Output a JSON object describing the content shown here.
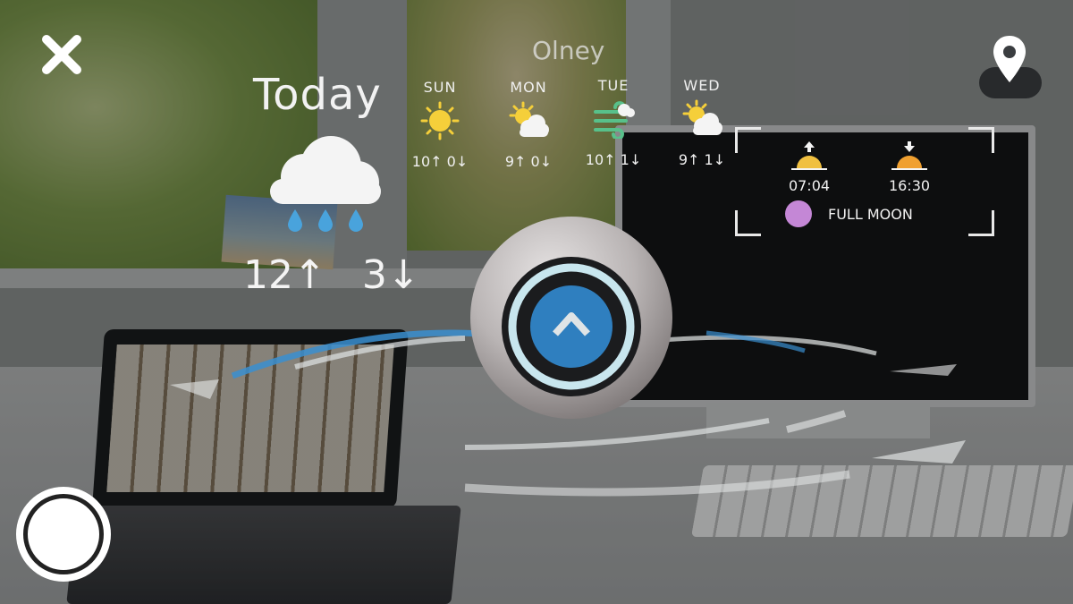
{
  "location_name": "Olney",
  "today": {
    "title": "Today",
    "condition_icon": "rain-cloud-icon",
    "high": "12",
    "low": "3"
  },
  "forecast": [
    {
      "day": "SUN",
      "icon": "sun-icon",
      "high": "10",
      "low": "0"
    },
    {
      "day": "MON",
      "icon": "sun-cloud-icon",
      "high": "9",
      "low": "0"
    },
    {
      "day": "TUE",
      "icon": "wind-icon",
      "high": "10",
      "low": "1"
    },
    {
      "day": "WED",
      "icon": "sun-cloud-icon",
      "high": "9",
      "low": "1"
    }
  ],
  "sun": {
    "sunrise": "07:04",
    "sunset": "16:30",
    "moon_phase": "FULL MOON"
  },
  "controls": {
    "close_icon": "close-icon",
    "location_icon": "location-pin-icon",
    "capture_icon": "shutter-button-icon",
    "orb_icon": "chevron-up-icon"
  },
  "colors": {
    "sun": "#f5cf3a",
    "sunrise_glow": "#f0c040",
    "moon": "#c487d6",
    "orb_accent": "#2f7fbf",
    "orb_ring": "#c8e6ee",
    "wind": "#58c08a"
  }
}
